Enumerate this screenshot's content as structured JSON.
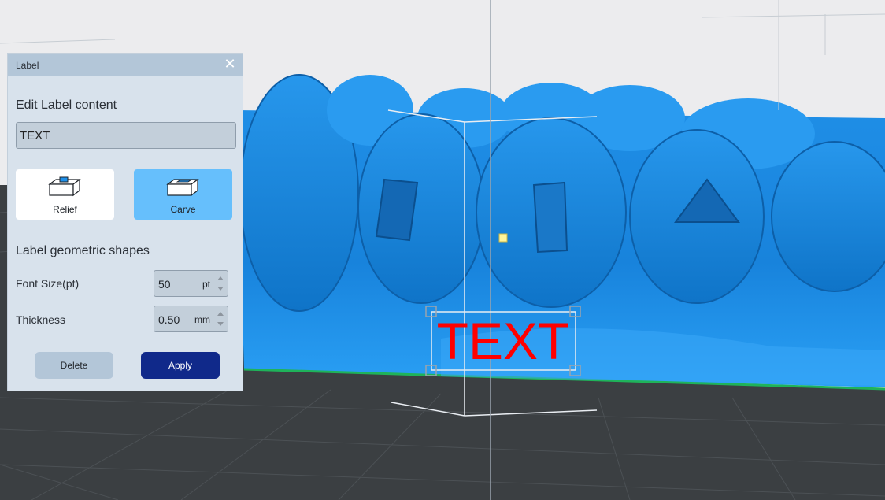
{
  "panel": {
    "title": "Label",
    "close_glyph": "✕",
    "edit_section_title": "Edit Label content",
    "label_text_value": "TEXT",
    "modes": [
      {
        "label": "Relief",
        "icon": "relief-box-icon"
      },
      {
        "label": "Carve",
        "icon": "carve-box-icon",
        "selected": true
      }
    ],
    "shape_section_title": "Label geometric shapes",
    "font_size": {
      "label": "Font Size(pt)",
      "value": "50",
      "unit": "pt"
    },
    "thickness": {
      "label": "Thickness",
      "value": "0.50",
      "unit": "mm"
    },
    "delete_label": "Delete",
    "apply_label": "Apply"
  },
  "viewport": {
    "label_preview_text": "TEXT",
    "colors": {
      "model": "#1e90e6",
      "model_highlight": "#47b0ff",
      "floor": "#3b3f42",
      "label_text": "#ff0000",
      "apply": "#10298a",
      "carve_selected": "#66bffc"
    }
  }
}
